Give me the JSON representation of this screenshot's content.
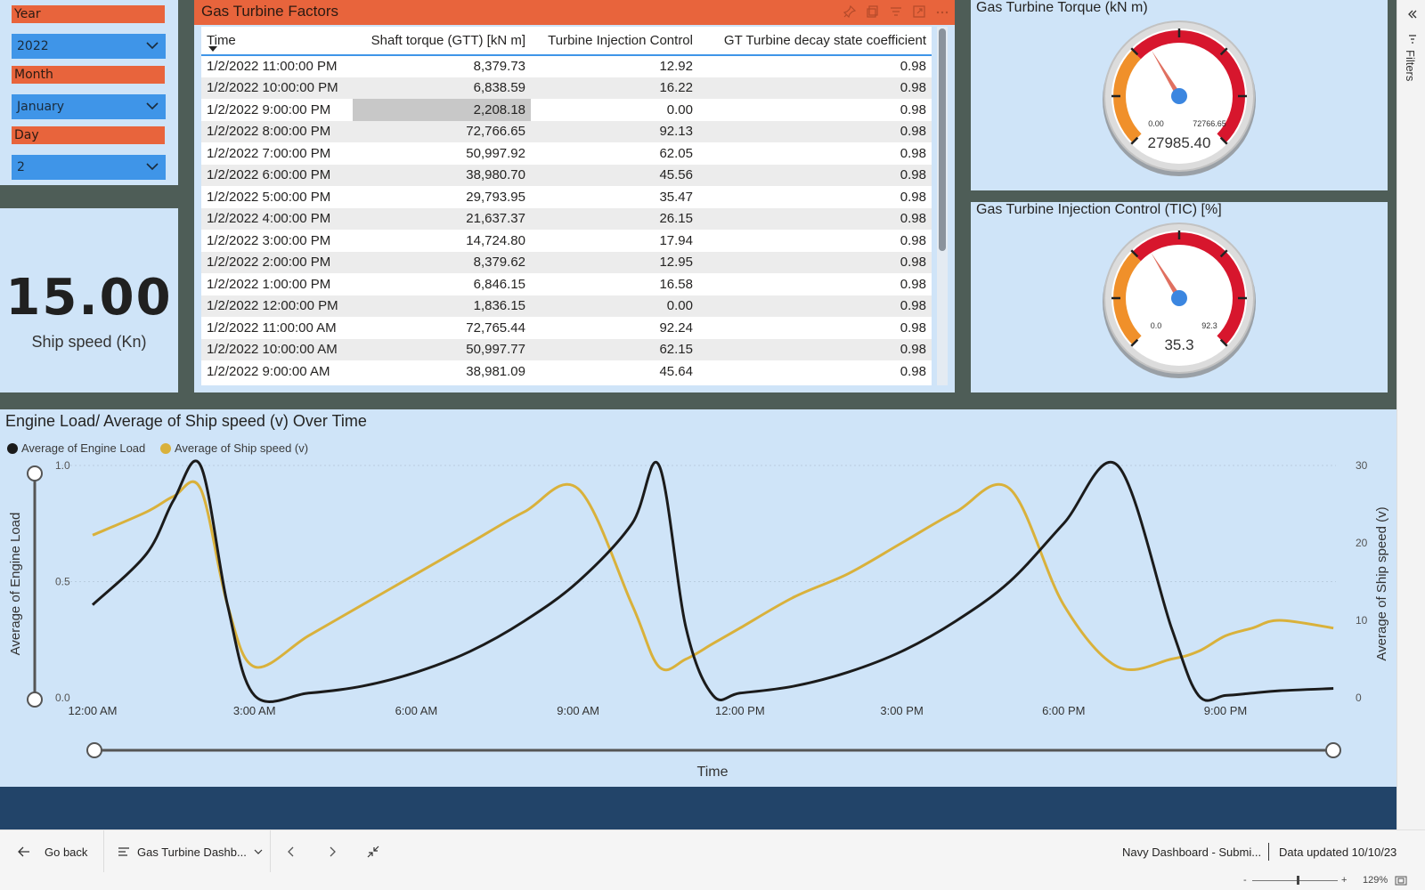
{
  "slicers": [
    {
      "label": "Year",
      "value": "2022"
    },
    {
      "label": "Month",
      "value": "January"
    },
    {
      "label": "Day",
      "value": "2"
    }
  ],
  "card": {
    "value": "15.00",
    "label": "Ship speed (Kn)"
  },
  "table": {
    "title": "Gas Turbine Factors",
    "columns": [
      "Time",
      "Shaft torque (GTT) [kN m]",
      "Turbine Injection Control",
      "GT Turbine decay state coefficient"
    ],
    "rows": [
      [
        "1/2/2022 11:00:00 PM",
        "8,379.73",
        "12.92",
        "0.98"
      ],
      [
        "1/2/2022 10:00:00 PM",
        "6,838.59",
        "16.22",
        "0.98"
      ],
      [
        "1/2/2022 9:00:00 PM",
        "2,208.18",
        "0.00",
        "0.98"
      ],
      [
        "1/2/2022 8:00:00 PM",
        "72,766.65",
        "92.13",
        "0.98"
      ],
      [
        "1/2/2022 7:00:00 PM",
        "50,997.92",
        "62.05",
        "0.98"
      ],
      [
        "1/2/2022 6:00:00 PM",
        "38,980.70",
        "45.56",
        "0.98"
      ],
      [
        "1/2/2022 5:00:00 PM",
        "29,793.95",
        "35.47",
        "0.98"
      ],
      [
        "1/2/2022 4:00:00 PM",
        "21,637.37",
        "26.15",
        "0.98"
      ],
      [
        "1/2/2022 3:00:00 PM",
        "14,724.80",
        "17.94",
        "0.98"
      ],
      [
        "1/2/2022 2:00:00 PM",
        "8,379.62",
        "12.95",
        "0.98"
      ],
      [
        "1/2/2022 1:00:00 PM",
        "6,846.15",
        "16.58",
        "0.98"
      ],
      [
        "1/2/2022 12:00:00 PM",
        "1,836.15",
        "0.00",
        "0.98"
      ],
      [
        "1/2/2022 11:00:00 AM",
        "72,765.44",
        "92.24",
        "0.98"
      ],
      [
        "1/2/2022 10:00:00 AM",
        "50,997.77",
        "62.15",
        "0.98"
      ],
      [
        "1/2/2022 9:00:00 AM",
        "38,981.09",
        "45.64",
        "0.98"
      ]
    ]
  },
  "gauges": [
    {
      "title": "Gas Turbine Torque (kN m)",
      "min": "0.00",
      "max": "72766.65",
      "value_label": "27985.40",
      "value": 27985.4,
      "min_num": 0,
      "max_num": 72766.65
    },
    {
      "title": "Gas Turbine Injection Control (TIC) [%]",
      "min": "0.0",
      "max": "92.3",
      "value_label": "35.3",
      "value": 35.3,
      "min_num": 0,
      "max_num": 92.3
    }
  ],
  "chart_data": {
    "type": "line",
    "title": "Engine Load/ Average of Ship speed (v) Over Time",
    "xlabel": "Time",
    "ylabel_left": "Average of Engine Load",
    "ylabel_right": "Average of Ship speed (v)",
    "x_ticks": [
      "12:00 AM",
      "3:00 AM",
      "6:00 AM",
      "9:00 AM",
      "12:00 PM",
      "3:00 PM",
      "6:00 PM",
      "9:00 PM"
    ],
    "y_left_ticks": [
      "1.0",
      "0.5",
      "0.0"
    ],
    "y_right_ticks": [
      "30",
      "20",
      "10",
      "0"
    ],
    "ylim_left": [
      0,
      1
    ],
    "ylim_right": [
      0,
      30
    ],
    "legend_position": "top-left",
    "x_hours": [
      0,
      1,
      1.5,
      2,
      2.5,
      3,
      4,
      5,
      6,
      7,
      8,
      9,
      10,
      10.5,
      11,
      11.5,
      12,
      13,
      14,
      15,
      16,
      17,
      18,
      19,
      20,
      20.5,
      21,
      21.5,
      22,
      23
    ],
    "series": [
      {
        "name": "Average of Engine Load",
        "color": "#1b1b1b",
        "values": [
          0.4,
          0.62,
          0.85,
          1.0,
          0.4,
          0.01,
          0.02,
          0.05,
          0.11,
          0.2,
          0.33,
          0.5,
          0.75,
          1.0,
          0.3,
          0.01,
          0.02,
          0.05,
          0.11,
          0.2,
          0.33,
          0.5,
          0.75,
          1.0,
          0.3,
          0.01,
          0.01,
          0.02,
          0.03,
          0.04
        ]
      },
      {
        "name": "Average of Ship speed (v)",
        "color": "#d9b13b",
        "values": [
          21,
          24,
          26,
          27,
          12,
          4,
          8,
          12,
          16,
          20,
          24,
          27,
          12,
          4,
          5,
          7,
          9,
          13,
          16,
          20,
          24,
          27,
          12,
          4,
          5,
          6,
          8,
          9,
          10,
          9
        ]
      }
    ]
  },
  "footer": {
    "go_back": "Go back",
    "page_name": "Gas Turbine Dashb...",
    "report_name": "Navy Dashboard - Submi...",
    "data_updated": "Data updated 10/10/23"
  },
  "status": {
    "zoom": "129%"
  },
  "filters_label": "Filters"
}
